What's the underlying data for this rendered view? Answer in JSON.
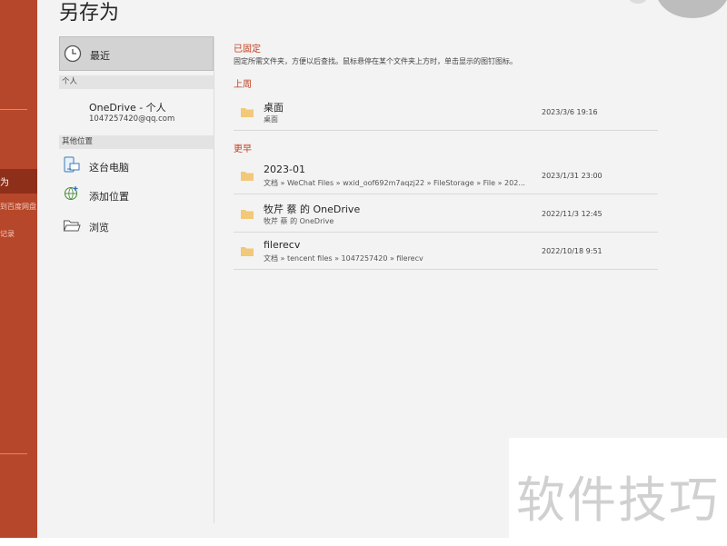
{
  "title": "另存为",
  "sidebar": {
    "active_label": "为",
    "sub_items": [
      "到百度网盘",
      "记录"
    ]
  },
  "locations": {
    "recent": "最近",
    "personal_header": "个人",
    "onedrive_name": "OneDrive - 个人",
    "onedrive_email": "1047257420@qq.com",
    "other_header": "其他位置",
    "this_pc": "这台电脑",
    "add_place": "添加位置",
    "browse": "浏览"
  },
  "files": {
    "pinned_title": "已固定",
    "pinned_hint": "固定所需文件夹，方便以后查找。鼠标悬停在某个文件夹上方时，单击显示的图钉图标。",
    "last_week_title": "上周",
    "earlier_title": "更早",
    "last_week": [
      {
        "name": "桌面",
        "path": "桌面",
        "date": "2023/3/6 19:16"
      }
    ],
    "earlier": [
      {
        "name": "2023-01",
        "path": "文档 » WeChat Files » wxid_oof692m7aqzj22 » FileStorage » File » 202...",
        "date": "2023/1/31 23:00"
      },
      {
        "name": "牧芹 蔡 的 OneDrive",
        "path": "牧芹 蔡 的 OneDrive",
        "date": "2022/11/3 12:45"
      },
      {
        "name": "filerecv",
        "path": "文档 » tencent files » 1047257420 » filerecv",
        "date": "2022/10/18 9:51"
      }
    ]
  },
  "watermark": "软件技巧",
  "colors": {
    "accent": "#b7472a",
    "accent_dark": "#8e2f19",
    "heading_red": "#c43e1c",
    "folder": "#f2c879"
  }
}
